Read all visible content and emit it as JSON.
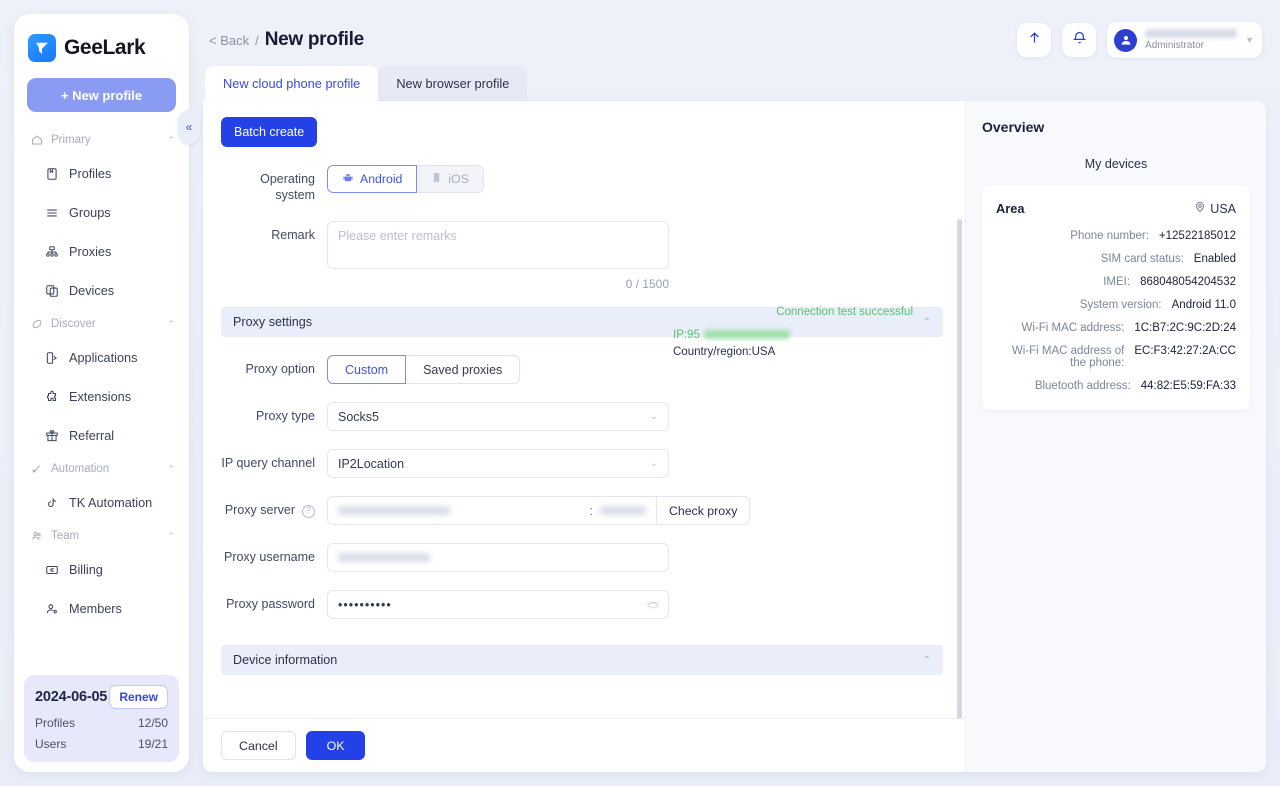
{
  "brand": {
    "name": "GeeLark",
    "new_profile": "+ New profile"
  },
  "sidebar": {
    "groups": [
      {
        "label": "Primary",
        "icon": "home-icon",
        "items": [
          {
            "label": "Profiles",
            "icon": "profiles-icon"
          },
          {
            "label": "Groups",
            "icon": "groups-icon"
          },
          {
            "label": "Proxies",
            "icon": "proxies-icon"
          },
          {
            "label": "Devices",
            "icon": "devices-icon"
          }
        ]
      },
      {
        "label": "Discover",
        "icon": "discover-icon",
        "items": [
          {
            "label": "Applications",
            "icon": "applications-icon"
          },
          {
            "label": "Extensions",
            "icon": "extensions-icon"
          },
          {
            "label": "Referral",
            "icon": "referral-icon"
          }
        ]
      },
      {
        "label": "Automation",
        "icon": "automation-icon",
        "items": [
          {
            "label": "TK Automation",
            "icon": "tiktok-icon"
          }
        ]
      },
      {
        "label": "Team",
        "icon": "team-icon",
        "items": [
          {
            "label": "Billing",
            "icon": "billing-icon"
          },
          {
            "label": "Members",
            "icon": "members-icon"
          }
        ]
      }
    ],
    "collapse_icon": "«",
    "plan": {
      "date": "2024-06-05",
      "renew_label": "Renew",
      "rows": [
        {
          "label": "Profiles",
          "value": "12/50"
        },
        {
          "label": "Users",
          "value": "19/21"
        }
      ]
    }
  },
  "topbar": {
    "back_label": "< Back",
    "separator": "/",
    "title": "New profile",
    "upload_icon": "upload-arrow-icon",
    "bell_icon": "bell-icon",
    "user": {
      "name": "",
      "role": "Administrator"
    }
  },
  "tabs": [
    {
      "label": "New cloud phone profile",
      "active": true
    },
    {
      "label": "New browser profile",
      "active": false
    }
  ],
  "form": {
    "batch_create": "Batch create",
    "os": {
      "label": "Operating system",
      "options": [
        {
          "label": "Android",
          "active": true
        },
        {
          "label": "iOS",
          "active": false
        }
      ]
    },
    "remark": {
      "label": "Remark",
      "placeholder": "Please enter remarks",
      "value": "",
      "counter": "0 / 1500"
    },
    "proxy_section": {
      "title": "Proxy settings",
      "chev": "⌃"
    },
    "proxy_option": {
      "label": "Proxy option",
      "options": [
        {
          "label": "Custom",
          "active": true
        },
        {
          "label": "Saved proxies",
          "active": false
        }
      ]
    },
    "proxy_type": {
      "label": "Proxy type",
      "value": "Socks5"
    },
    "ip_query_channel": {
      "label": "IP query channel",
      "value": "IP2Location"
    },
    "proxy_server": {
      "label": "Proxy server",
      "help_icon": "question-mark-icon",
      "host": "",
      "colon": ":",
      "port": "",
      "check_button": "Check proxy"
    },
    "connection": {
      "status": "Connection test successful",
      "ip_line": "IP:95",
      "country_line": "Country/region:USA"
    },
    "proxy_username": {
      "label": "Proxy username",
      "value": ""
    },
    "proxy_password": {
      "label": "Proxy password",
      "value": "••••••••••",
      "eye_icon": "eye-off-icon"
    },
    "device_section": {
      "title": "Device information",
      "chev": "⌃"
    },
    "footer": {
      "cancel": "Cancel",
      "ok": "OK"
    }
  },
  "overview": {
    "title": "Overview",
    "subtitle": "My devices",
    "area": {
      "label": "Area",
      "value": "USA",
      "icon": "location-pin-icon"
    },
    "rows": [
      {
        "key": "Phone number:",
        "value": "+12522185012"
      },
      {
        "key": "SIM card status:",
        "value": "Enabled"
      },
      {
        "key": "IMEI:",
        "value": "868048054204532"
      },
      {
        "key": "System version:",
        "value": "Android 11.0"
      },
      {
        "key": "Wi-Fi MAC address:",
        "value": "1C:B7:2C:9C:2D:24"
      },
      {
        "key": "Wi-Fi MAC address of the phone:",
        "value": "EC:F3:42:27:2A:CC"
      },
      {
        "key": "Bluetooth address:",
        "value": "44:82:E5:59:FA:33"
      }
    ]
  },
  "colors": {
    "accent": "#2341e6",
    "brand_blue": "#1677ff",
    "success_green": "#5bc36b",
    "page_bg": "#eef1f8"
  }
}
